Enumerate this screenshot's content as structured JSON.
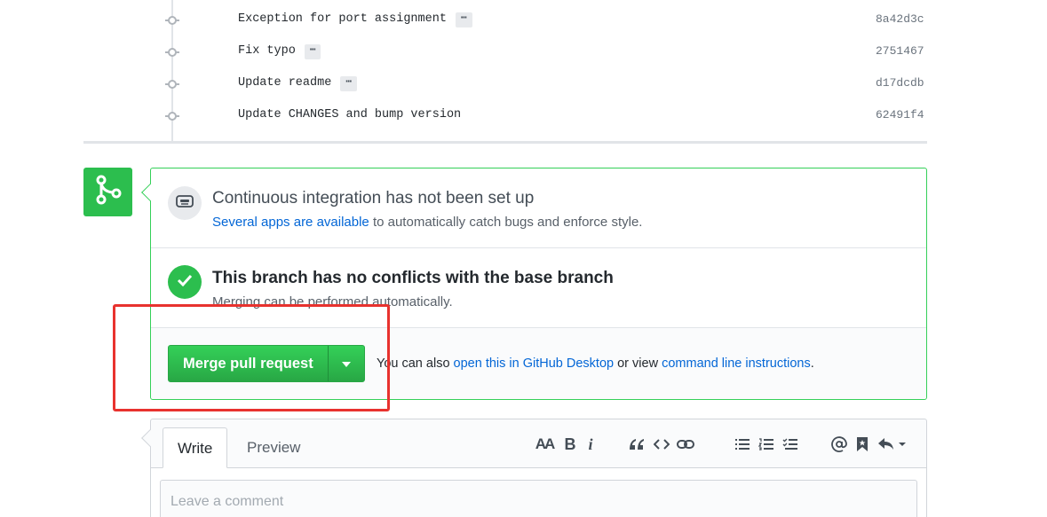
{
  "commits": [
    {
      "message": "Exception for port assignment",
      "has_ellipsis": true,
      "sha": "8a42d3c"
    },
    {
      "message": "Fix typo",
      "has_ellipsis": true,
      "sha": "2751467"
    },
    {
      "message": "Update readme",
      "has_ellipsis": true,
      "sha": "d17dcdb"
    },
    {
      "message": "Update CHANGES and bump version",
      "has_ellipsis": false,
      "sha": "62491f4"
    }
  ],
  "ellipsis_label": "⋯",
  "ci": {
    "title": "Continuous integration has not been set up",
    "link_text": "Several apps are available",
    "rest_text": " to automatically catch bugs and enforce style."
  },
  "conflicts": {
    "title": "This branch has no conflicts with the base branch",
    "subtitle": "Merging can be performed automatically."
  },
  "merge": {
    "button_label": "Merge pull request",
    "also_prefix": "You can also ",
    "desktop_link": "open this in GitHub Desktop",
    "middle_text": " or view ",
    "cli_link": "command line instructions",
    "suffix": "."
  },
  "editor": {
    "tab_write": "Write",
    "tab_preview": "Preview",
    "placeholder": "Leave a comment",
    "toolbar_header": "AA",
    "toolbar_bold": "B",
    "toolbar_italic": "i"
  },
  "colors": {
    "accent_green": "#2cbe4e",
    "link_blue": "#0366d6",
    "highlight_red": "#e8322e"
  }
}
